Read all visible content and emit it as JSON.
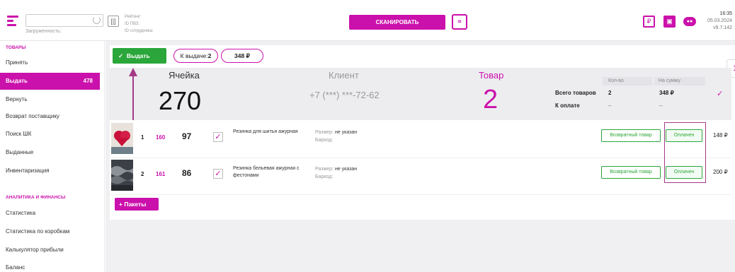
{
  "header": {
    "loading_label": "Загруженность:",
    "info_lines": [
      "Рейтинг:",
      "ID ПВЗ:",
      "ID сотрудника:"
    ],
    "scan_button": "СКАНИРОВАТЬ",
    "qr_icon_text": "[QR]",
    "time": "16:35",
    "date": "05.03.2024",
    "version": "v9.7.142"
  },
  "sidebar": {
    "section_goods": "ТОВАРЫ",
    "items_goods": [
      {
        "label": "Принять"
      },
      {
        "label": "Выдать",
        "count": "478"
      },
      {
        "label": "Вернуть"
      },
      {
        "label": "Возврат поставщику"
      },
      {
        "label": "Поиск ШК"
      },
      {
        "label": "Выданные"
      },
      {
        "label": "Инвентаризация"
      }
    ],
    "section_analytics": "АНАЛИТИКА И ФИНАНСЫ",
    "items_analytics": [
      {
        "label": "Статистика"
      },
      {
        "label": "Статистика по коробкам"
      },
      {
        "label": "Калькулятор прибыли"
      },
      {
        "label": "Баланс"
      }
    ]
  },
  "toolbar": {
    "give_button": "Выдать",
    "to_issue_label": "К выдаче:",
    "to_issue_value": "2",
    "total_pill": "348 ₽"
  },
  "stats": {
    "cell_label": "Ячейка",
    "cell_value": "270",
    "client_label": "Клиент",
    "client_phone": "+7 (***) ***-72-62",
    "goods_label": "Товар",
    "goods_value": "2",
    "col_qty": "Кол-во",
    "col_sum": "На сумму",
    "row_total_label": "Всего товаров",
    "row_total_qty": "2",
    "row_total_sum": "348 ₽",
    "row_pay_label": "К оплате",
    "row_pay_qty": "–",
    "row_pay_sum": "–"
  },
  "items": [
    {
      "index": "1",
      "cell": "160",
      "code": "97",
      "name": "Резинка для шитья ажурная",
      "size_label": "Размер:",
      "size_value": "не указан",
      "barcode_label": "Баркод:",
      "return_label": "Возвратный товар",
      "status": "Оплачен",
      "price": "148 ₽"
    },
    {
      "index": "2",
      "cell": "161",
      "code": "86",
      "name": "Резинка бельевая ажурная с фестонами",
      "size_label": "Размер:",
      "size_value": "не указан",
      "barcode_label": "Баркод:",
      "return_label": "Возвратный товар",
      "status": "Оплачен",
      "price": "200 ₽"
    }
  ],
  "packages_button": "Пакеты",
  "colors": {
    "brand": "#cb11ab",
    "success": "#2aa63a"
  }
}
